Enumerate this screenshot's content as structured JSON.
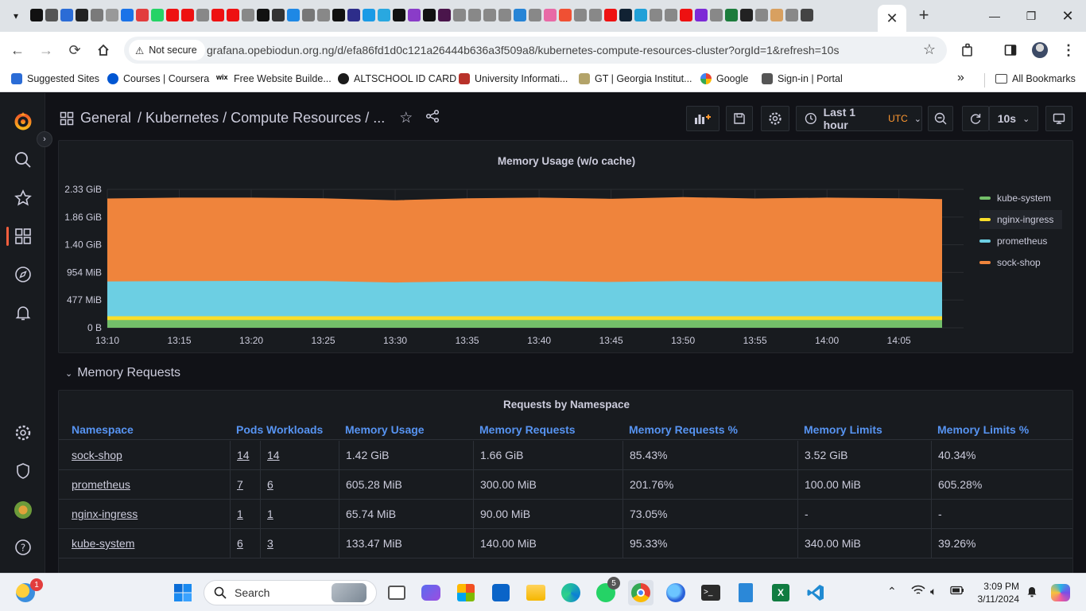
{
  "browser": {
    "active_tab_close": "✕",
    "new_tab": "+",
    "security_label": "Not secure",
    "url": "grafana.opebiodun.org.ng/d/efa86fd1d0c121a26444b636a3f509a8/kubernetes-compute-resources-cluster?orgId=1&refresh=10s",
    "bookmarks": [
      {
        "label": "Suggested Sites"
      },
      {
        "label": "Courses | Coursera"
      },
      {
        "label": "Free Website Builde..."
      },
      {
        "label": "ALTSCHOOL ID CARD"
      },
      {
        "label": "University Informati..."
      },
      {
        "label": "GT | Georgia Institut..."
      },
      {
        "label": "Google"
      },
      {
        "label": "Sign-in | Portal"
      }
    ],
    "all_bookmarks": "All Bookmarks",
    "more_bookmarks": "»"
  },
  "grafana": {
    "breadcrumb": {
      "general": "General",
      "path": "/ Kubernetes / Compute Resources / ..."
    },
    "time_range": "Last 1 hour",
    "timezone": "UTC",
    "refresh": "10s",
    "memory_panel": {
      "title": "Memory Usage (w/o cache)",
      "legend": [
        {
          "name": "kube-system",
          "color": "#73bf69"
        },
        {
          "name": "nginx-ingress",
          "color": "#fade2a"
        },
        {
          "name": "prometheus",
          "color": "#6ccfe3"
        },
        {
          "name": "sock-shop",
          "color": "#ef843c"
        }
      ]
    },
    "row_title": "Memory Requests",
    "table_panel": {
      "title": "Requests by Namespace",
      "columns": [
        "Namespace",
        "Pods",
        "Workloads",
        "Memory Usage",
        "Memory Requests",
        "Memory Requests %",
        "Memory Limits",
        "Memory Limits %"
      ],
      "rows": [
        [
          "sock-shop",
          "14",
          "14",
          "1.42 GiB",
          "1.66 GiB",
          "85.43%",
          "3.52 GiB",
          "40.34%"
        ],
        [
          "prometheus",
          "7",
          "6",
          "605.28 MiB",
          "300.00 MiB",
          "201.76%",
          "100.00 MiB",
          "605.28%"
        ],
        [
          "nginx-ingress",
          "1",
          "1",
          "65.74 MiB",
          "90.00 MiB",
          "73.05%",
          "-",
          "-"
        ],
        [
          "kube-system",
          "6",
          "3",
          "133.47 MiB",
          "140.00 MiB",
          "95.33%",
          "340.00 MiB",
          "39.26%"
        ]
      ]
    }
  },
  "chart_data": {
    "type": "area",
    "title": "Memory Usage (w/o cache)",
    "stacked": true,
    "y_tick_labels": [
      "0 B",
      "477 MiB",
      "954 MiB",
      "1.40 GiB",
      "1.86 GiB",
      "2.33 GiB"
    ],
    "y_tick_values_mib": [
      0,
      477,
      954,
      1430,
      1907,
      2384
    ],
    "ylim_mib": [
      0,
      2384
    ],
    "x_tick_labels": [
      "13:10",
      "13:15",
      "13:20",
      "13:25",
      "13:30",
      "13:35",
      "13:40",
      "13:45",
      "13:50",
      "13:55",
      "14:00",
      "14:05"
    ],
    "x_range": [
      "13:10",
      "14:08"
    ],
    "x": [
      "13:10",
      "13:15",
      "13:20",
      "13:25",
      "13:30",
      "13:35",
      "13:40",
      "13:45",
      "13:50",
      "13:55",
      "14:00",
      "14:05",
      "14:08"
    ],
    "series": [
      {
        "name": "kube-system",
        "color": "#73bf69",
        "values": [
          133,
          133,
          133,
          133,
          133,
          133,
          133,
          133,
          133,
          133,
          133,
          133,
          133
        ]
      },
      {
        "name": "nginx-ingress",
        "color": "#fade2a",
        "values": [
          66,
          66,
          66,
          66,
          66,
          66,
          66,
          66,
          66,
          66,
          66,
          66,
          66
        ]
      },
      {
        "name": "prometheus",
        "color": "#6ccfe3",
        "values": [
          600,
          605,
          610,
          605,
          580,
          600,
          605,
          590,
          605,
          600,
          605,
          600,
          590
        ]
      },
      {
        "name": "sock-shop",
        "color": "#ef843c",
        "values": [
          1420,
          1430,
          1425,
          1420,
          1410,
          1425,
          1430,
          1425,
          1440,
          1420,
          1430,
          1425,
          1420
        ]
      }
    ],
    "legend_position": "right",
    "grid": true
  }
}
